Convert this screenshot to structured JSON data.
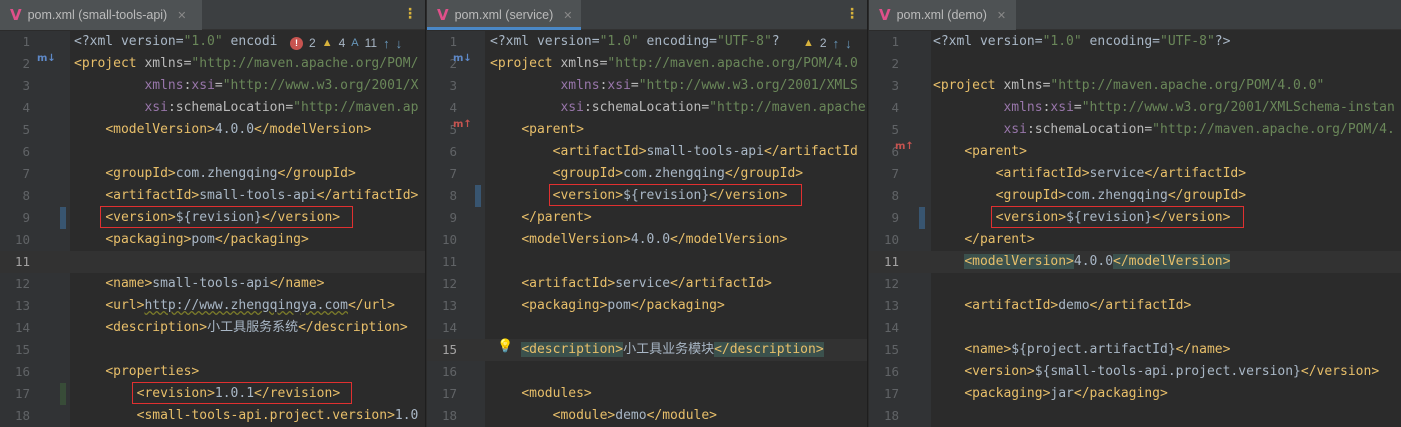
{
  "panes": [
    {
      "tab_label": "pom.xml (small-tools-api)",
      "active": false,
      "inspections": {
        "errors": "2",
        "warnings": "4",
        "typos": "11"
      },
      "lines": [
        {
          "n": "1",
          "html": "<span class='pi'>&lt;?xml version=</span><span class='val'>\"1.0\"</span><span class='pi'> encodi</span>"
        },
        {
          "n": "2",
          "html": "<span class='tag'>&lt;project</span> <span class='attr'>xmlns=</span><span class='val'>\"http://maven.apache.org/POM/</span>"
        },
        {
          "n": "3",
          "html": "         <span class='ns'>xmlns</span><span class='attr'>:</span><span class='ns'>xsi</span><span class='attr'>=</span><span class='val'>\"http://www.w3.org/2001/X</span>"
        },
        {
          "n": "4",
          "html": "         <span class='ns'>xsi</span><span class='attr'>:schemaLocation=</span><span class='val'>\"http://maven.ap</span>"
        },
        {
          "n": "5",
          "html": "    <span class='tag'>&lt;modelVersion&gt;</span>4.0.0<span class='tag'>&lt;/modelVersion&gt;</span>"
        },
        {
          "n": "6",
          "html": ""
        },
        {
          "n": "7",
          "html": "    <span class='tag'>&lt;groupId&gt;</span>com.zhengqing<span class='tag'>&lt;/groupId&gt;</span>"
        },
        {
          "n": "8",
          "html": "    <span class='tag'>&lt;artifactId&gt;</span>small-tools-api<span class='tag'>&lt;/artifactId&gt;</span>"
        },
        {
          "n": "9",
          "html": "    <span class='tag'>&lt;version&gt;</span>${revision}<span class='tag'>&lt;/version&gt;</span>"
        },
        {
          "n": "10",
          "html": "    <span class='tag'>&lt;packaging&gt;</span>pom<span class='tag'>&lt;/packaging&gt;</span>"
        },
        {
          "n": "11",
          "html": "",
          "current": true
        },
        {
          "n": "12",
          "html": "    <span class='tag'>&lt;name&gt;</span>small-tools-api<span class='tag'>&lt;/name&gt;</span>"
        },
        {
          "n": "13",
          "html": "    <span class='tag'>&lt;url&gt;</span><span class='url'>http://www.zhengqingya.com</span><span class='tag'>&lt;/url&gt;</span>"
        },
        {
          "n": "14",
          "html": "    <span class='tag'>&lt;description&gt;</span>小工具服务系统<span class='tag'>&lt;/description&gt;</span>"
        },
        {
          "n": "15",
          "html": ""
        },
        {
          "n": "16",
          "html": "    <span class='tag'>&lt;properties&gt;</span>"
        },
        {
          "n": "17",
          "html": "        <span class='tag'>&lt;revision&gt;</span>1.0.1<span class='tag'>&lt;/revision&gt;</span>"
        },
        {
          "n": "18",
          "html": "        <span class='tag'>&lt;small-tools-api.project.version&gt;</span>1.0"
        }
      ]
    },
    {
      "tab_label": "pom.xml (service)",
      "active": true,
      "inspections": {
        "warnings": "2"
      },
      "lines": [
        {
          "n": "1",
          "html": "<span class='pi'>&lt;?xml version=</span><span class='val'>\"1.0\"</span><span class='pi'> encoding=</span><span class='val'>\"UTF-8\"</span><span class='pi'>?</span>"
        },
        {
          "n": "2",
          "html": "<span class='tag'>&lt;project</span> <span class='attr'>xmlns=</span><span class='val'>\"http://maven.apache.org/POM/4.0</span>"
        },
        {
          "n": "3",
          "html": "         <span class='ns'>xmlns</span><span class='attr'>:</span><span class='ns'>xsi</span><span class='attr'>=</span><span class='val'>\"http://www.w3.org/2001/XMLS</span>"
        },
        {
          "n": "4",
          "html": "         <span class='ns'>xsi</span><span class='attr'>:schemaLocation=</span><span class='val'>\"http://maven.apache</span>"
        },
        {
          "n": "5",
          "html": "    <span class='tag'>&lt;parent&gt;</span>"
        },
        {
          "n": "6",
          "html": "        <span class='tag'>&lt;artifactId&gt;</span>small-tools-api<span class='tag'>&lt;/artifactId</span>"
        },
        {
          "n": "7",
          "html": "        <span class='tag'>&lt;groupId&gt;</span>com.zhengqing<span class='tag'>&lt;/groupId&gt;</span>"
        },
        {
          "n": "8",
          "html": "        <span class='tag'>&lt;version&gt;</span>${revision}<span class='tag'>&lt;/version&gt;</span>"
        },
        {
          "n": "9",
          "html": "    <span class='tag'>&lt;/parent&gt;</span>"
        },
        {
          "n": "10",
          "html": "    <span class='tag'>&lt;modelVersion&gt;</span>4.0.0<span class='tag'>&lt;/modelVersion&gt;</span>"
        },
        {
          "n": "11",
          "html": ""
        },
        {
          "n": "12",
          "html": "    <span class='tag'>&lt;artifactId&gt;</span>service<span class='tag'>&lt;/artifactId&gt;</span>"
        },
        {
          "n": "13",
          "html": "    <span class='tag'>&lt;packaging&gt;</span>pom<span class='tag'>&lt;/packaging&gt;</span>"
        },
        {
          "n": "14",
          "html": ""
        },
        {
          "n": "15",
          "html": "    <span class='tag hl'>&lt;description&gt;</span>小工具业务模块<span class='tag hl'>&lt;/description&gt;</span>",
          "current": true
        },
        {
          "n": "16",
          "html": ""
        },
        {
          "n": "17",
          "html": "    <span class='tag'>&lt;modules&gt;</span>"
        },
        {
          "n": "18",
          "html": "        <span class='tag'>&lt;module&gt;</span>demo<span class='tag'>&lt;/module&gt;</span>"
        }
      ]
    },
    {
      "tab_label": "pom.xml (demo)",
      "active": false,
      "inspections": {},
      "lines": [
        {
          "n": "1",
          "html": "<span class='pi'>&lt;?xml version=</span><span class='val'>\"1.0\"</span><span class='pi'> encoding=</span><span class='val'>\"UTF-8\"</span><span class='pi'>?&gt;</span>"
        },
        {
          "n": "2",
          "html": ""
        },
        {
          "n": "3",
          "html": "<span class='tag'>&lt;project</span> <span class='attr'>xmlns=</span><span class='val'>\"http://maven.apache.org/POM/4.0.0\"</span>"
        },
        {
          "n": "4",
          "html": "         <span class='ns'>xmlns</span><span class='attr'>:</span><span class='ns'>xsi</span><span class='attr'>=</span><span class='val'>\"http://www.w3.org/2001/XMLSchema-instan</span>"
        },
        {
          "n": "5",
          "html": "         <span class='ns'>xsi</span><span class='attr'>:schemaLocation=</span><span class='val'>\"http://maven.apache.org/POM/4.</span>"
        },
        {
          "n": "6",
          "html": "    <span class='tag'>&lt;parent&gt;</span>"
        },
        {
          "n": "7",
          "html": "        <span class='tag'>&lt;artifactId&gt;</span>service<span class='tag'>&lt;/artifactId&gt;</span>"
        },
        {
          "n": "8",
          "html": "        <span class='tag'>&lt;groupId&gt;</span>com.zhengqing<span class='tag'>&lt;/groupId&gt;</span>"
        },
        {
          "n": "9",
          "html": "        <span class='tag'>&lt;version&gt;</span>${revision}<span class='tag'>&lt;/version&gt;</span>"
        },
        {
          "n": "10",
          "html": "    <span class='tag'>&lt;/parent&gt;</span>"
        },
        {
          "n": "11",
          "html": "    <span class='tag hl'>&lt;modelVersion&gt;</span>4.0.0<span class='tag hl'>&lt;/modelVersion&gt;</span>",
          "current": true
        },
        {
          "n": "12",
          "html": ""
        },
        {
          "n": "13",
          "html": "    <span class='tag'>&lt;artifactId&gt;</span>demo<span class='tag'>&lt;/artifactId&gt;</span>"
        },
        {
          "n": "14",
          "html": ""
        },
        {
          "n": "15",
          "html": "    <span class='tag'>&lt;name&gt;</span>${project.artifactId}<span class='tag'>&lt;/name&gt;</span>"
        },
        {
          "n": "16",
          "html": "    <span class='tag'>&lt;version&gt;</span>${small-tools-api.project.version}<span class='tag'>&lt;/version&gt;</span>"
        },
        {
          "n": "17",
          "html": "    <span class='tag'>&lt;packaging&gt;</span>jar<span class='tag'>&lt;/packaging&gt;</span>"
        },
        {
          "n": "18",
          "html": ""
        }
      ]
    }
  ],
  "icons": {
    "file": "V",
    "close": "✕",
    "kebab": "⋮",
    "maven_modules": "m↓",
    "maven_parent": "m↑",
    "bulb": "💡",
    "up": "↑",
    "down": "↓"
  },
  "colors": {
    "background": "#2b2b2b",
    "tag": "#e8bf6a",
    "string": "#6a8759",
    "namespace": "#9876aa",
    "annotation_box": "#e03030"
  }
}
